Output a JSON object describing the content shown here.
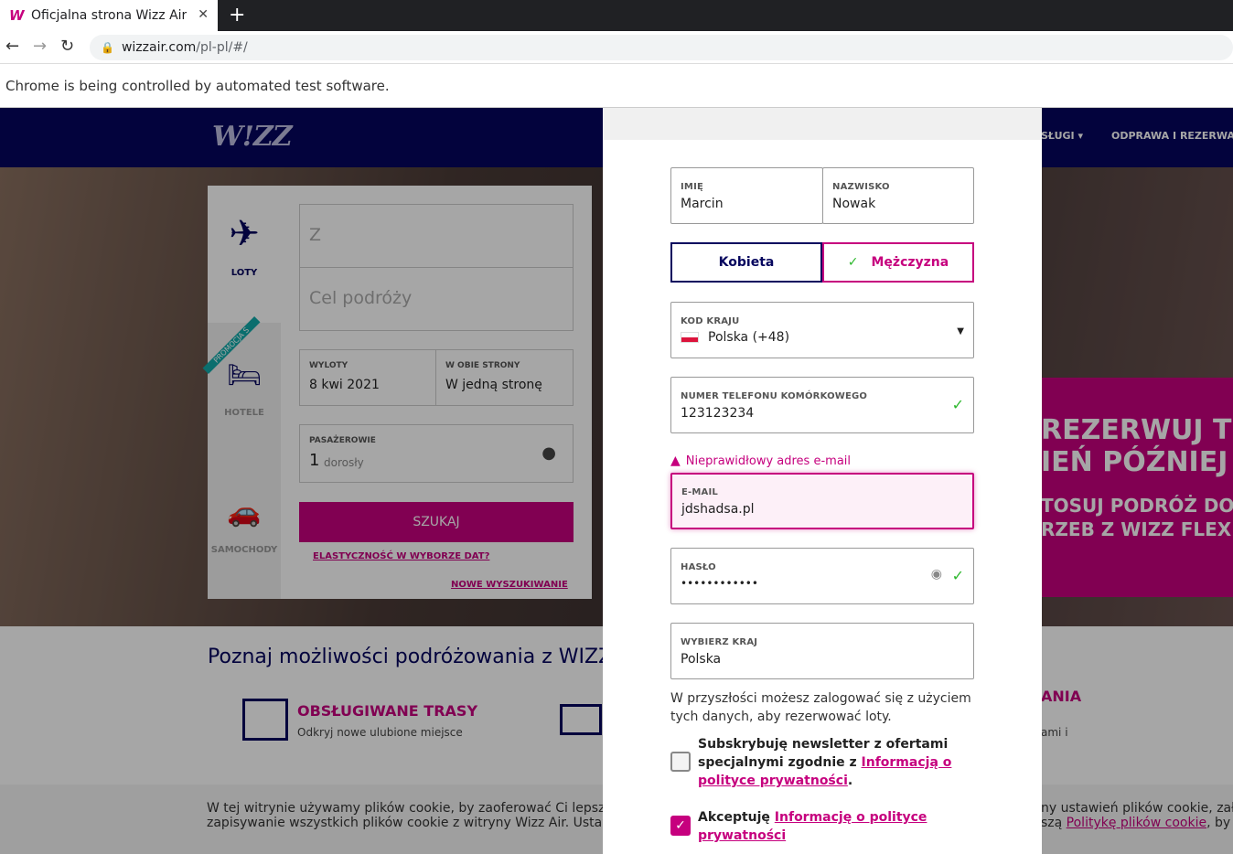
{
  "browser": {
    "tab_title": "Oficjalna strona Wizz Air | ",
    "new_tab": "+",
    "close": "✕",
    "url_host": "wizzair.com",
    "url_path": "/pl-pl/#/",
    "automation_notice": "Chrome is being controlled by automated test software."
  },
  "site": {
    "logo": "W!ZZ",
    "nav_services": "SŁUGI ▾",
    "nav_checkin": "ODPRAWA I REZERWAC",
    "search": {
      "tabs": {
        "flights": "LOTY",
        "hotels": "HOTELE",
        "cars": "SAMOCHODY",
        "promo_badge": "PROMOCJA S"
      },
      "from_placeholder": "Z",
      "to_placeholder": "Cel podróży",
      "departures_label": "WYLOTY",
      "departures_value": "8 kwi 2021",
      "return_label": "W OBIE STRONY",
      "return_value": "W jedną stronę",
      "passengers_label": "PASAŻEROWIE",
      "passengers_value": "1",
      "passengers_unit": "dorosły",
      "search_button": "SZUKAJ",
      "flex_link": "ELASTYCZNOŚĆ W WYBORZE DAT?",
      "new_search_link": "NOWE WYSZUKIWANIE"
    },
    "promo": {
      "line1": "REZERWUJ T",
      "line2": "IEŃ PÓŹNIEJ",
      "line3": "TOSUJ PODRÓŻ DO",
      "line4": "RZEB Z WIZZ FLEX"
    },
    "discover_title": "Poznaj możliwości podróżowania z WIZZ",
    "routes_title": "OBSŁUGIWANE TRASY",
    "routes_sub": "Odkryj nowe ulubione miejsce",
    "right_title": "ANIA",
    "right_sub": "ami i",
    "cookie_l1": "W tej witrynie używamy plików cookie, by zaoferować Ci lepsze us",
    "cookie_l2": "zapisywanie wszystkich plików cookie z witryny Wizz Air. Ustawien",
    "cookie_r1": "ny ustawień plików cookie, zało",
    "cookie_r2_pre": "szą ",
    "cookie_r2_link": "Politykę plików cookie",
    "cookie_r2_post": ", by dc"
  },
  "modal": {
    "first_name_label": "IMIĘ",
    "first_name_value": "Marcin",
    "last_name_label": "NAZWISKO",
    "last_name_value": "Nowak",
    "gender_female": "Kobieta",
    "gender_male": "Mężczyzna",
    "country_code_label": "KOD KRAJU",
    "country_code_value": "Polska (+48)",
    "phone_label": "NUMER TELEFONU KOMÓRKOWEGO",
    "phone_value": "123123234",
    "email_error": "Nieprawidłowy adres e-mail",
    "email_label": "E-MAIL",
    "email_value": "jdshadsa.pl",
    "password_label": "HASŁO",
    "password_value": "••••••••••••",
    "country_label": "WYBIERZ KRAJ",
    "country_value": "Polska",
    "info_text": "W przyszłości możesz zalogować się z użyciem tych danych, aby rezerwować loty.",
    "newsletter_text": "Subskrybuję newsletter z ofertami specjalnymi zgodnie z ",
    "newsletter_link": "Informacją o polityce prywatności",
    "newsletter_post": ".",
    "accept_text": "Akceptuję ",
    "accept_link": "Informację o polityce prywatności",
    "check_icon": "✓",
    "colors": {
      "brand_magenta": "#c6007e",
      "brand_navy": "#06065e",
      "valid_green": "#2eb82e"
    }
  }
}
